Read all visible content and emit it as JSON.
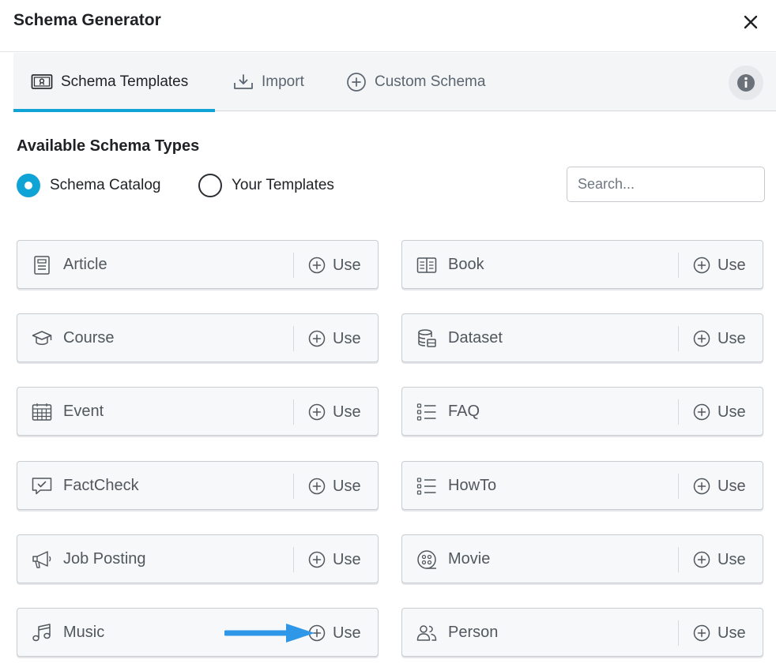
{
  "dialog": {
    "title": "Schema Generator"
  },
  "tabs": [
    {
      "label": "Schema Templates",
      "icon": "certificate-icon",
      "active": true
    },
    {
      "label": "Import",
      "icon": "download-icon",
      "active": false
    },
    {
      "label": "Custom Schema",
      "icon": "plus-circle-icon",
      "active": false
    }
  ],
  "section": {
    "title": "Available Schema Types",
    "options": [
      {
        "label": "Schema Catalog",
        "selected": true
      },
      {
        "label": "Your Templates",
        "selected": false
      }
    ],
    "search_placeholder": "Search..."
  },
  "use_label": "Use",
  "schemas": [
    {
      "name": "Article",
      "icon": "article-icon"
    },
    {
      "name": "Book",
      "icon": "book-icon"
    },
    {
      "name": "Course",
      "icon": "graduation-cap-icon"
    },
    {
      "name": "Dataset",
      "icon": "database-icon"
    },
    {
      "name": "Event",
      "icon": "calendar-icon"
    },
    {
      "name": "FAQ",
      "icon": "list-icon"
    },
    {
      "name": "FactCheck",
      "icon": "message-check-icon"
    },
    {
      "name": "HowTo",
      "icon": "list-icon"
    },
    {
      "name": "Job Posting",
      "icon": "megaphone-icon"
    },
    {
      "name": "Movie",
      "icon": "film-reel-icon"
    },
    {
      "name": "Music",
      "icon": "music-note-icon"
    },
    {
      "name": "Person",
      "icon": "users-icon"
    }
  ],
  "colors": {
    "accent": "#10a3d6",
    "arrow": "#2f97e8"
  }
}
